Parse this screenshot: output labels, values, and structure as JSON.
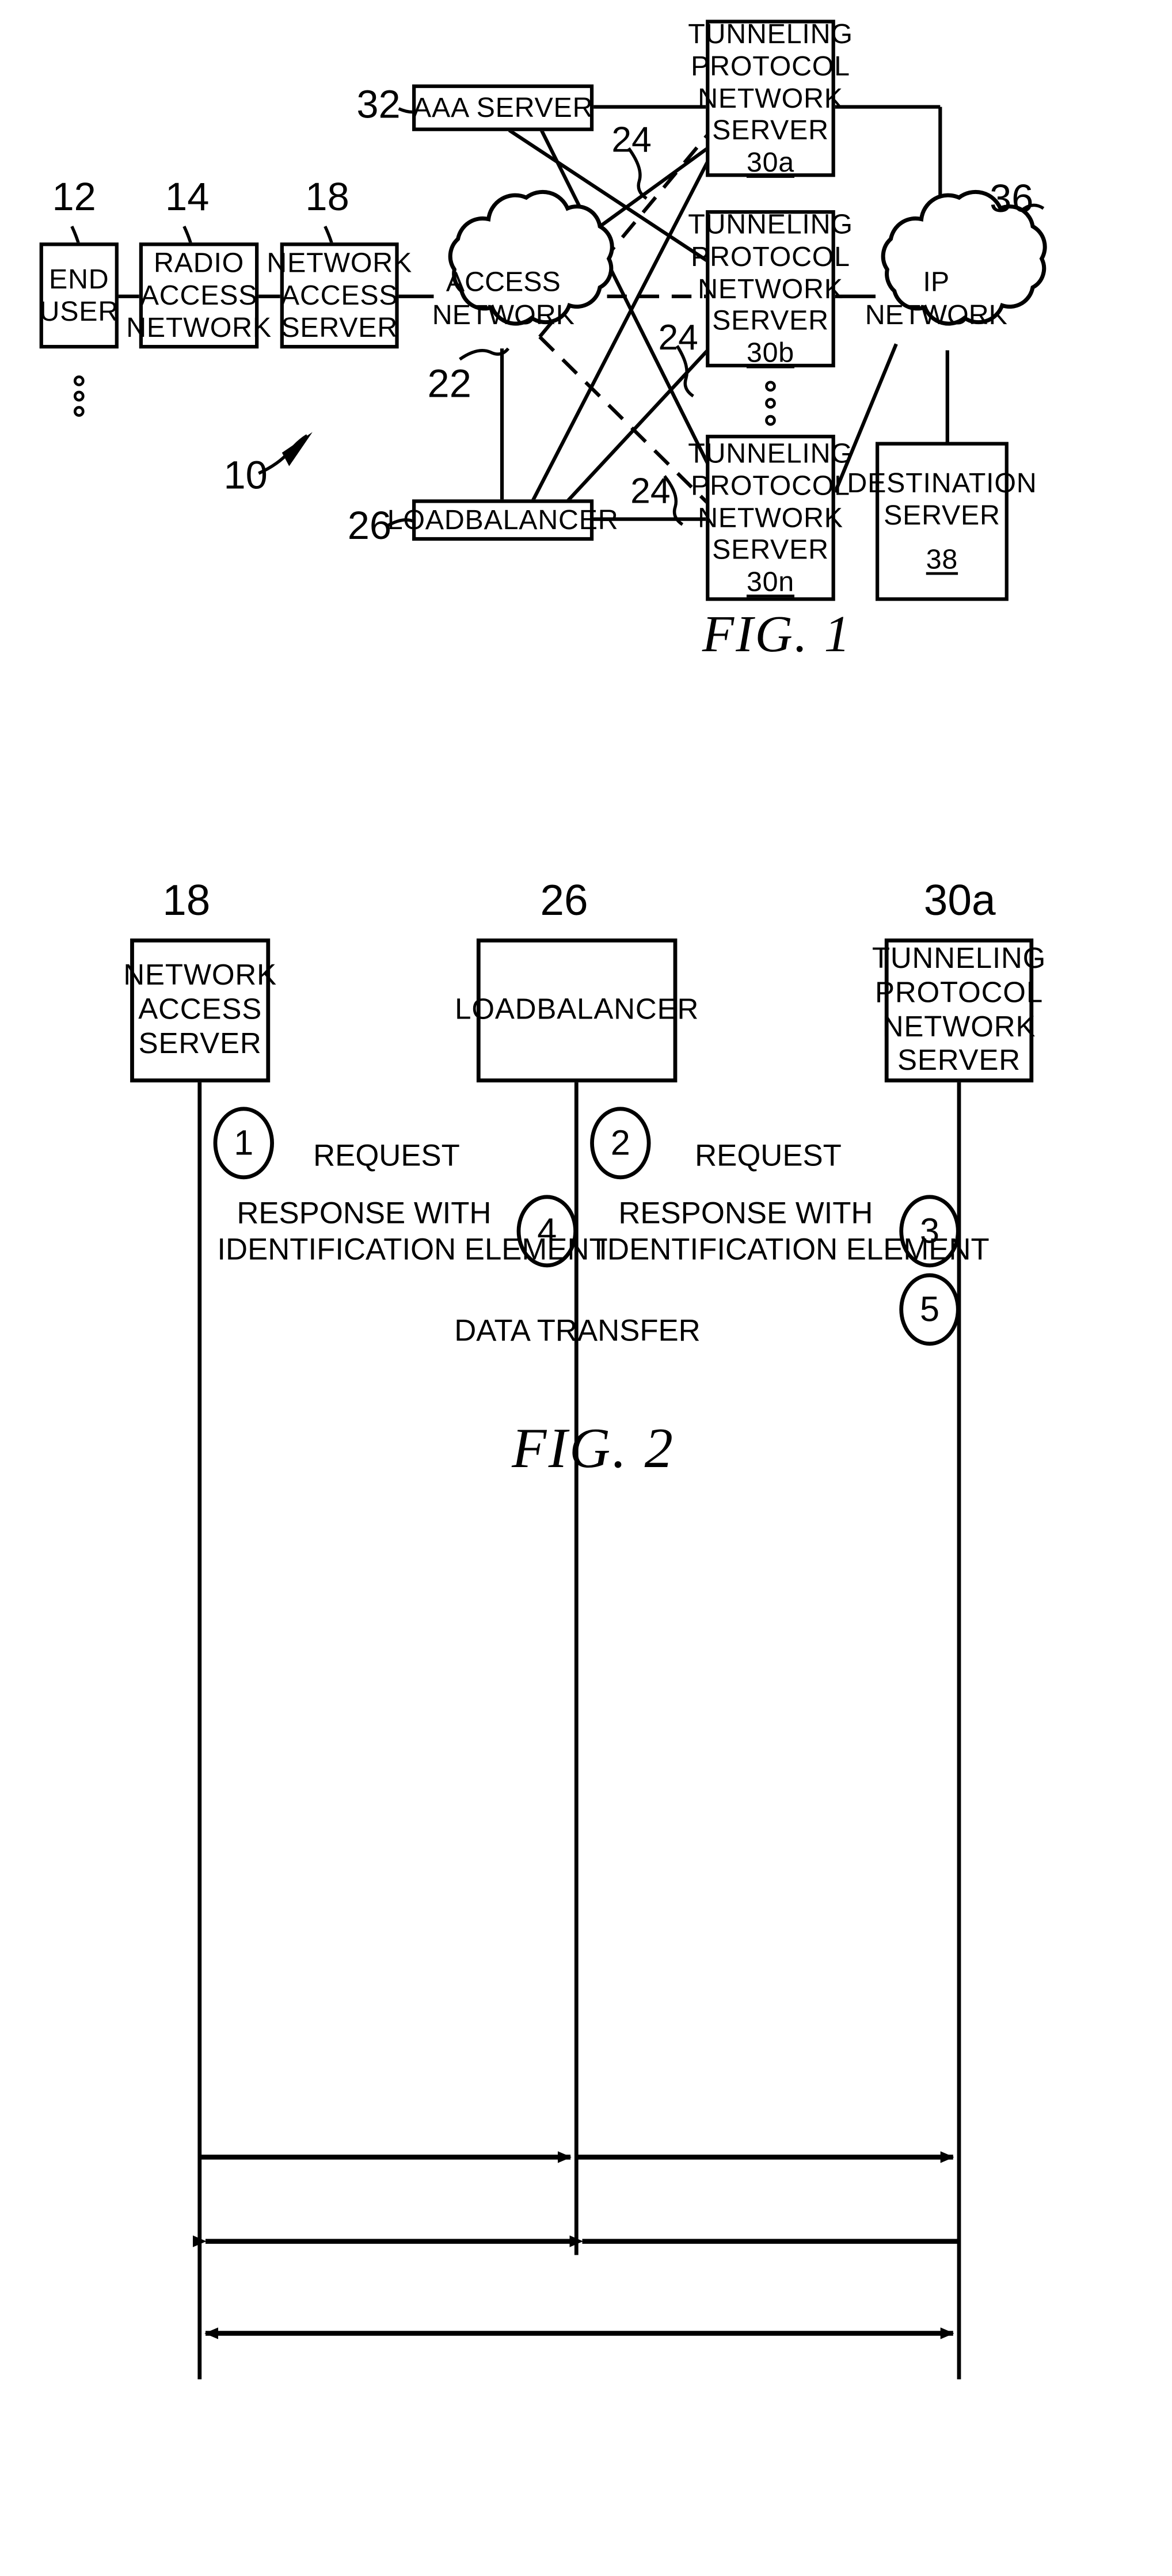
{
  "figure1": {
    "caption": "FIG.  1",
    "system_ref": "10",
    "nodes": [
      {
        "id": "end-user",
        "label_lines": [
          "END",
          "USER"
        ],
        "ref": "12"
      },
      {
        "id": "radio-access-network",
        "label_lines": [
          "RADIO",
          "ACCESS",
          "NETWORK"
        ],
        "ref": "14"
      },
      {
        "id": "network-access-server",
        "label_lines": [
          "NETWORK",
          "ACCESS",
          "SERVER"
        ],
        "ref": "18"
      },
      {
        "id": "access-network",
        "label_lines": [
          "ACCESS",
          "NETWORK"
        ],
        "ref": "22"
      },
      {
        "id": "aaa-server",
        "label_lines": [
          "AAA  SERVER"
        ],
        "ref": "32"
      },
      {
        "id": "loadbalancer",
        "label_lines": [
          "LOADBALANCER"
        ],
        "ref": "26"
      },
      {
        "id": "tunneling-protocol-network-server-30a",
        "label_lines": [
          "TUNNELING",
          "PROTOCOL",
          "NETWORK",
          "SERVER"
        ],
        "ref": "30a"
      },
      {
        "id": "tunneling-protocol-network-server-30b",
        "label_lines": [
          "TUNNELING",
          "PROTOCOL",
          "NETWORK",
          "SERVER"
        ],
        "ref": "30b"
      },
      {
        "id": "tunneling-protocol-network-server-30n",
        "label_lines": [
          "TUNNELING",
          "PROTOCOL",
          "NETWORK",
          "SERVER"
        ],
        "ref": "30n"
      },
      {
        "id": "ip-network",
        "label_lines": [
          "IP",
          "NETWORK"
        ],
        "ref": "36"
      },
      {
        "id": "destination-server",
        "label_lines": [
          "DESTINATION",
          "SERVER"
        ],
        "ref": "38"
      }
    ],
    "tunnel_ref_a": "30a",
    "tunnel_ref_b": "30b",
    "tunnel_ref_n": "30n",
    "destination_ref": "38",
    "tunnel_labels": [
      "TUNNELING",
      "PROTOCOL",
      "NETWORK",
      "SERVER"
    ],
    "aaa_label": "AAA  SERVER",
    "loadbalancer_label": "LOADBALANCER",
    "end_user": [
      "END",
      "USER"
    ],
    "radio_access": [
      "RADIO",
      "ACCESS",
      "NETWORK"
    ],
    "network_access": [
      "NETWORK",
      "ACCESS",
      "SERVER"
    ],
    "access_network": [
      "ACCESS",
      "NETWORK"
    ],
    "ip_network": [
      "IP",
      "NETWORK"
    ],
    "destination_server": [
      "DESTINATION",
      "SERVER"
    ],
    "tunnel_link_ref": "24",
    "refs": {
      "r12": "12",
      "r14": "14",
      "r18": "18",
      "r22": "22",
      "r24a": "24",
      "r24b": "24",
      "r24c": "24",
      "r26": "26",
      "r32": "32",
      "r36": "36",
      "r10": "10"
    }
  },
  "figure2": {
    "caption": "FIG.  2",
    "lifelines": [
      {
        "id": "network-access-server",
        "label_lines": [
          "NETWORK",
          "ACCESS",
          "SERVER"
        ],
        "ref": "18"
      },
      {
        "id": "loadbalancer",
        "label_lines": [
          "LOADBALANCER"
        ],
        "ref": "26"
      },
      {
        "id": "tunneling-protocol-network-server",
        "label_lines": [
          "TUNNELING",
          "PROTOCOL",
          "NETWORK",
          "SERVER"
        ],
        "ref": "30a"
      }
    ],
    "nas_label": [
      "NETWORK",
      "ACCESS",
      "SERVER"
    ],
    "lb_label": "LOADBALANCER",
    "tpns_label": [
      "TUNNELING",
      "PROTOCOL",
      "NETWORK",
      "SERVER"
    ],
    "ref_18": "18",
    "ref_26": "26",
    "ref_30a": "30a",
    "messages": [
      {
        "step": "1",
        "label": "REQUEST",
        "from": "network-access-server",
        "to": "loadbalancer",
        "direction": "right"
      },
      {
        "step": "2",
        "label": "REQUEST",
        "from": "loadbalancer",
        "to": "tunneling-protocol-network-server",
        "direction": "right"
      },
      {
        "step": "4",
        "label_lines": [
          "RESPONSE  WITH",
          "IDENTIFICATION  ELEMENT"
        ],
        "from": "loadbalancer",
        "to": "network-access-server",
        "direction": "left"
      },
      {
        "step": "3",
        "label_lines": [
          "RESPONSE  WITH",
          "IDENTIFICATION  ELEMENT"
        ],
        "from": "tunneling-protocol-network-server",
        "to": "loadbalancer",
        "direction": "left"
      },
      {
        "step": "5",
        "label": "DATA  TRANSFER",
        "from": "network-access-server",
        "to": "tunneling-protocol-network-server",
        "direction": "both"
      }
    ],
    "m1_label": "REQUEST",
    "m2_label": "REQUEST",
    "m4_l1": "RESPONSE  WITH",
    "m4_l2": "IDENTIFICATION  ELEMENT",
    "m3_l1": "RESPONSE  WITH",
    "m3_l2": "IDENTIFICATION  ELEMENT",
    "m5_label": "DATA  TRANSFER",
    "steps": {
      "s1": "1",
      "s2": "2",
      "s3": "3",
      "s4": "4",
      "s5": "5"
    }
  },
  "colors": {
    "ink": "#000000",
    "paper": "#ffffff"
  }
}
